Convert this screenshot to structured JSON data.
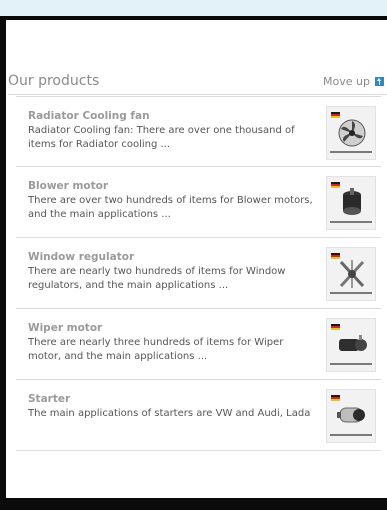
{
  "header": {
    "title": "Our products",
    "move_up_label": "Move up"
  },
  "products": [
    {
      "title": "Radiator Cooling fan",
      "description": "Radiator Cooling fan: There are over one thousand of items for Radiator cooling ...",
      "image_icon": "fan-icon"
    },
    {
      "title": "Blower motor",
      "description": "There are over two hundreds of items for Blower motors, and the main applications ...",
      "image_icon": "blower-icon"
    },
    {
      "title": "Window regulator",
      "description": "There are nearly two hundreds of items for Window regulators, and the main applications ...",
      "image_icon": "regulator-icon"
    },
    {
      "title": "Wiper motor",
      "description": "There are nearly three hundreds of items for Wiper motor, and the main applications ...",
      "image_icon": "wiper-icon"
    },
    {
      "title": "Starter",
      "description": "The main applications of starters are VW and Audi, Lada",
      "image_icon": "starter-icon"
    }
  ],
  "colors": {
    "accent": "#2f86c9",
    "page_bg": "#0b0b0b",
    "top_strip": "#e3f1f8"
  }
}
